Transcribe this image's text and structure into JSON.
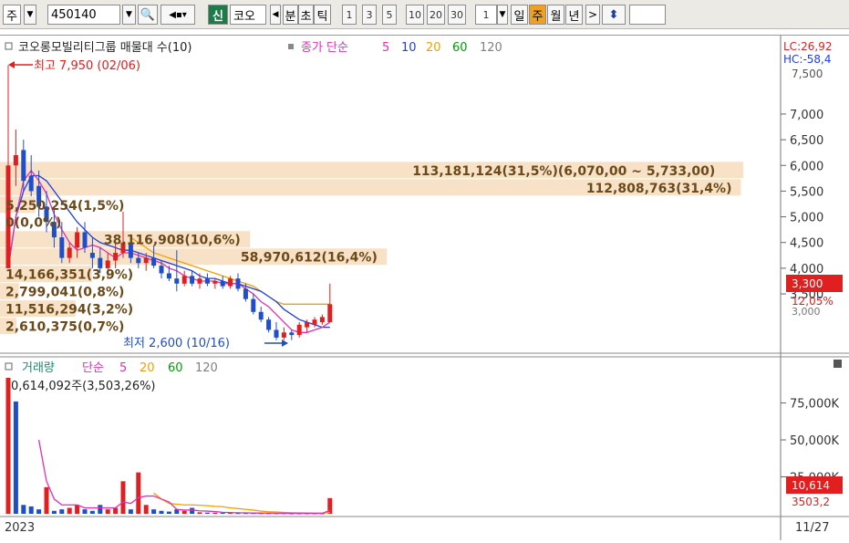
{
  "toolbar": {
    "market_label": "주",
    "code_value": "450140",
    "badge_new": "신",
    "name_value": "코오",
    "period_buttons": [
      "분",
      "초",
      "틱"
    ],
    "number_buttons": [
      "1",
      "3",
      "5",
      "10",
      "20",
      "30"
    ],
    "interval_value": "1",
    "unit_buttons": [
      "일",
      "주",
      "월",
      "년"
    ],
    "active_unit": "주"
  },
  "price_panel": {
    "legend_title": "코오롱모빌리티그룹 매물대 수(10)",
    "legend_close": "종가 단순",
    "legend_periods": [
      "5",
      "10",
      "20",
      "60",
      "120"
    ],
    "lc_label": "LC:26,92",
    "hc_label": "HC:-58,4",
    "high_annotation": "최고 7,950 (02/06)",
    "low_annotation": "최저 2,600 (10/16)",
    "current_price": "3,300",
    "current_change": "12,05%",
    "partial_tick": "3,000",
    "top_partial_tick": "7,500"
  },
  "volume_panel": {
    "legend_title": "거래량",
    "legend_ma": "단순",
    "legend_periods": [
      "5",
      "20",
      "60",
      "120"
    ],
    "max_annotation": "0,614,092주(3,503,26%)",
    "current_volume": "10,614",
    "current_ratio": "3503,2"
  },
  "footer": {
    "year_label": "2023",
    "last_date": "11/27"
  },
  "colors": {
    "up": "#e02020",
    "down": "#1e4ec8",
    "ma5": "#e030b0",
    "ma10": "#2040e0",
    "ma20": "#f0a000",
    "ma60": "#00a000",
    "ma120": "#808080",
    "profile_bar": "#f7e2c8",
    "profile_text": "#6b4a1a"
  },
  "chart_data": [
    {
      "type": "candlestick",
      "title": "코오롱모빌리티그룹 매물대 수(10)",
      "y_ticks": [
        "7,000",
        "6,500",
        "6,000",
        "5,500",
        "5,000",
        "4,500",
        "4,000",
        "3,500"
      ],
      "ylim": [
        2400,
        8100
      ],
      "x_start_label": "2023",
      "x_end_label": "11/27",
      "candles": [
        {
          "o": 4000,
          "h": 7950,
          "l": 4000,
          "c": 6000
        },
        {
          "o": 6000,
          "h": 6700,
          "l": 5600,
          "c": 6200
        },
        {
          "o": 6300,
          "h": 6500,
          "l": 5500,
          "c": 5700
        },
        {
          "o": 5800,
          "h": 6200,
          "l": 5400,
          "c": 5500
        },
        {
          "o": 5600,
          "h": 5900,
          "l": 5000,
          "c": 5200
        },
        {
          "o": 5200,
          "h": 5500,
          "l": 4700,
          "c": 4900
        },
        {
          "o": 4900,
          "h": 5200,
          "l": 4400,
          "c": 4600
        },
        {
          "o": 4600,
          "h": 4900,
          "l": 4100,
          "c": 4200
        },
        {
          "o": 4200,
          "h": 4500,
          "l": 4100,
          "c": 4400
        },
        {
          "o": 4400,
          "h": 4800,
          "l": 4200,
          "c": 4700
        },
        {
          "o": 4700,
          "h": 4900,
          "l": 4300,
          "c": 4400
        },
        {
          "o": 4300,
          "h": 4600,
          "l": 4000,
          "c": 4200
        },
        {
          "o": 4200,
          "h": 4400,
          "l": 3900,
          "c": 4000
        },
        {
          "o": 4000,
          "h": 4300,
          "l": 3800,
          "c": 4150
        },
        {
          "o": 4150,
          "h": 4500,
          "l": 4000,
          "c": 4300
        },
        {
          "o": 4300,
          "h": 5100,
          "l": 4200,
          "c": 4500
        },
        {
          "o": 4500,
          "h": 4600,
          "l": 4100,
          "c": 4200
        },
        {
          "o": 4200,
          "h": 4300,
          "l": 4000,
          "c": 4100
        },
        {
          "o": 4100,
          "h": 4300,
          "l": 3950,
          "c": 4200
        },
        {
          "o": 4200,
          "h": 4450,
          "l": 4000,
          "c": 4050
        },
        {
          "o": 4050,
          "h": 4150,
          "l": 3800,
          "c": 3900
        },
        {
          "o": 3900,
          "h": 4050,
          "l": 3750,
          "c": 3800
        },
        {
          "o": 3800,
          "h": 4350,
          "l": 3550,
          "c": 3700
        },
        {
          "o": 3700,
          "h": 3950,
          "l": 3650,
          "c": 3850
        },
        {
          "o": 3850,
          "h": 3950,
          "l": 3650,
          "c": 3700
        },
        {
          "o": 3700,
          "h": 3900,
          "l": 3600,
          "c": 3800
        },
        {
          "o": 3800,
          "h": 3900,
          "l": 3650,
          "c": 3700
        },
        {
          "o": 3700,
          "h": 3800,
          "l": 3600,
          "c": 3750
        },
        {
          "o": 3750,
          "h": 3850,
          "l": 3600,
          "c": 3650
        },
        {
          "o": 3650,
          "h": 3850,
          "l": 3600,
          "c": 3800
        },
        {
          "o": 3800,
          "h": 3900,
          "l": 3550,
          "c": 3600
        },
        {
          "o": 3600,
          "h": 3700,
          "l": 3350,
          "c": 3400
        },
        {
          "o": 3400,
          "h": 3500,
          "l": 3100,
          "c": 3150
        },
        {
          "o": 3150,
          "h": 3250,
          "l": 2950,
          "c": 3000
        },
        {
          "o": 3000,
          "h": 3050,
          "l": 2750,
          "c": 2800
        },
        {
          "o": 2800,
          "h": 2950,
          "l": 2600,
          "c": 2650
        },
        {
          "o": 2650,
          "h": 2850,
          "l": 2600,
          "c": 2750
        },
        {
          "o": 2750,
          "h": 2800,
          "l": 2600,
          "c": 2700
        },
        {
          "o": 2700,
          "h": 2950,
          "l": 2650,
          "c": 2900
        },
        {
          "o": 2850,
          "h": 3000,
          "l": 2750,
          "c": 2950
        },
        {
          "o": 2900,
          "h": 3050,
          "l": 2850,
          "c": 3000
        },
        {
          "o": 2950,
          "h": 3100,
          "l": 2900,
          "c": 3050
        },
        {
          "o": 2950,
          "h": 3700,
          "l": 2950,
          "c": 3300
        }
      ],
      "ma5": [
        4000,
        5000,
        5700,
        5900,
        5700,
        5450,
        5050,
        4750,
        4500,
        4350,
        4400,
        4450,
        4400,
        4300,
        4200,
        4300,
        4300,
        4250,
        4200,
        4150,
        4100,
        4000,
        3950,
        3850,
        3800,
        3750,
        3750,
        3750,
        3700,
        3700,
        3700,
        3600,
        3500,
        3350,
        3250,
        3100,
        2950,
        2800,
        2750,
        2750,
        2800,
        2850,
        2950
      ],
      "ma10": [
        4000,
        5000,
        5500,
        5800,
        5800,
        5700,
        5500,
        5300,
        5100,
        4900,
        4750,
        4600,
        4500,
        4450,
        4400,
        4350,
        4350,
        4300,
        4250,
        4200,
        4150,
        4100,
        4050,
        4000,
        3950,
        3850,
        3800,
        3800,
        3750,
        3700,
        3700,
        3650,
        3600,
        3550,
        3450,
        3350,
        3200,
        3100,
        3000,
        2950,
        2900,
        2850,
        2850
      ],
      "ma20_from": 16,
      "ma20": [
        4600,
        4500,
        4400,
        4300,
        4250,
        4200,
        4150,
        4100,
        4050,
        4000,
        3950,
        3900,
        3850,
        3800,
        3750,
        3700,
        3650,
        3550,
        3450,
        3350,
        3300,
        3300,
        3300,
        3300,
        3300,
        3300,
        3300
      ],
      "volume_profile": [
        {
          "label": "113,181,124(31,5%)(6,070,00 ~ 5,733,00)",
          "price_top": 6070,
          "price_bottom": 5733,
          "pct": 31.5
        },
        {
          "label": "112,808,763(31,4%)",
          "price_top": 5733,
          "price_bottom": 5396,
          "pct": 31.4
        },
        {
          "label": "5,250,254(1,5%)",
          "price_top": 5396,
          "price_bottom": 5059,
          "pct": 1.5
        },
        {
          "label": "0(0,0%)",
          "price_top": 5059,
          "price_bottom": 4722,
          "pct": 0.0
        },
        {
          "label": "38,116,908(10,6%)",
          "price_top": 4722,
          "price_bottom": 4385,
          "pct": 10.6
        },
        {
          "label": "58,970,612(16,4%)",
          "price_top": 4385,
          "price_bottom": 4048,
          "pct": 16.4
        },
        {
          "label": "14,166,351(3,9%)",
          "price_top": 4048,
          "price_bottom": 3711,
          "pct": 3.9
        },
        {
          "label": "2,799,041(0,8%)",
          "price_top": 3711,
          "price_bottom": 3374,
          "pct": 0.8
        },
        {
          "label": "11,516,294(3,2%)",
          "price_top": 3374,
          "price_bottom": 3037,
          "pct": 3.2
        },
        {
          "label": "2,610,375(0,7%)",
          "price_top": 3037,
          "price_bottom": 2700,
          "pct": 0.7
        }
      ]
    },
    {
      "type": "bar",
      "title": "거래량",
      "y_ticks": [
        "75,000K",
        "50,000K",
        "25,000K"
      ],
      "ylim": [
        0,
        92000
      ],
      "values": [
        92000,
        76000,
        6000,
        5000,
        3000,
        18000,
        2000,
        3000,
        4000,
        6000,
        3000,
        2000,
        6000,
        3000,
        4000,
        22000,
        3000,
        28000,
        6000,
        3000,
        2000,
        1500,
        3000,
        2000,
        4000,
        1000,
        800,
        700,
        600,
        600,
        500,
        500,
        500,
        400,
        400,
        400,
        400,
        300,
        300,
        300,
        300,
        300,
        10614
      ],
      "up": [
        true,
        false,
        false,
        false,
        false,
        true,
        false,
        false,
        true,
        true,
        false,
        false,
        false,
        true,
        true,
        true,
        false,
        true,
        true,
        false,
        false,
        false,
        false,
        true,
        false,
        true,
        false,
        true,
        false,
        true,
        false,
        false,
        false,
        false,
        false,
        false,
        true,
        false,
        true,
        true,
        true,
        true,
        true
      ],
      "ma5": [
        null,
        null,
        null,
        null,
        50000,
        22000,
        10000,
        6000,
        6000,
        6000,
        4000,
        4000,
        4000,
        4000,
        4000,
        8000,
        7000,
        11000,
        12000,
        12000,
        10000,
        8000,
        3000,
        2500,
        2500,
        2000,
        1800,
        1500,
        1000,
        800,
        700,
        600,
        500,
        500,
        450,
        400,
        400,
        380,
        350,
        330,
        320,
        300,
        2300
      ],
      "ma20": [
        null,
        null,
        null,
        null,
        null,
        null,
        null,
        null,
        null,
        null,
        null,
        null,
        null,
        null,
        null,
        null,
        null,
        null,
        null,
        14000,
        10000,
        7000,
        6500,
        6000,
        6000,
        5800,
        5500,
        5000,
        4800,
        4000,
        3500,
        3000,
        2500,
        1800,
        1400,
        1200,
        900,
        700,
        600,
        600,
        550,
        500,
        900
      ]
    }
  ]
}
